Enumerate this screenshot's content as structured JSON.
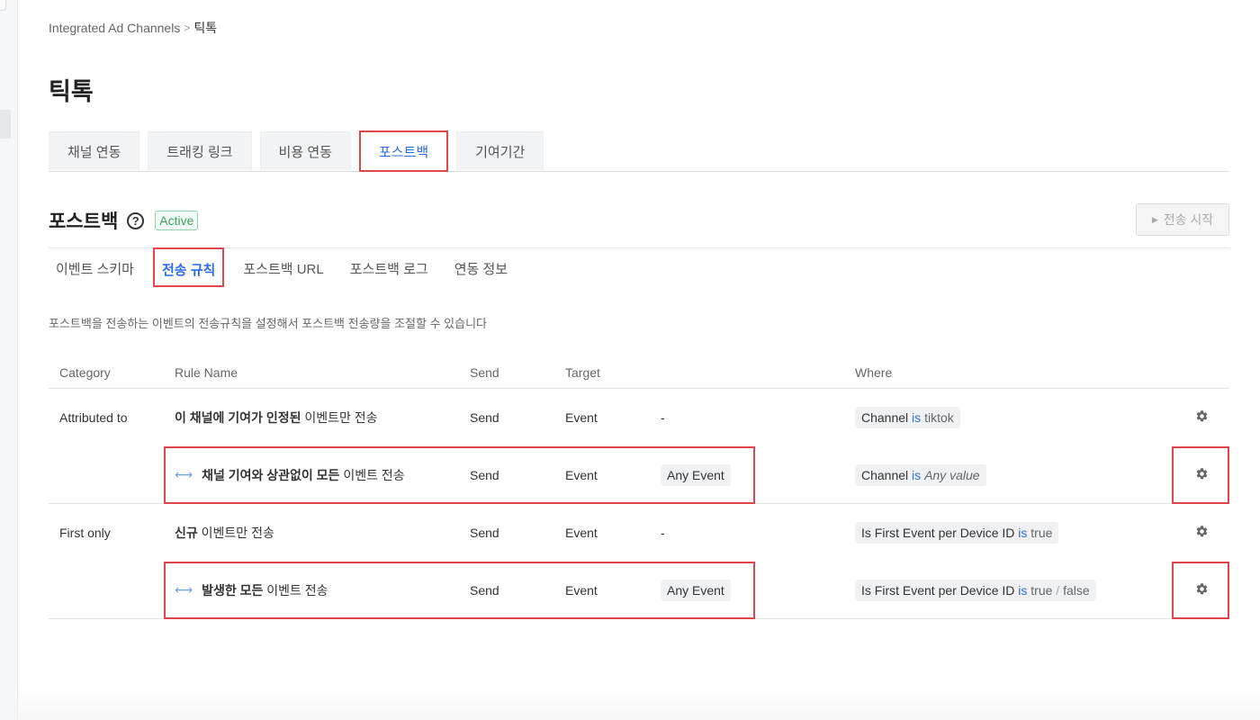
{
  "breadcrumb": {
    "parent": "Integrated Ad Channels",
    "separator": ">",
    "current": "틱톡"
  },
  "page_title": "틱톡",
  "tabs": [
    {
      "label": "채널 연동",
      "active": false
    },
    {
      "label": "트래킹 링크",
      "active": false
    },
    {
      "label": "비용 연동",
      "active": false
    },
    {
      "label": "포스트백",
      "active": true
    },
    {
      "label": "기여기간",
      "active": false
    }
  ],
  "section": {
    "title": "포스트백",
    "help_icon": "question-circle-icon",
    "help_glyph": "?",
    "status": "Active",
    "start_button": {
      "icon": "play-icon",
      "glyph": "▶",
      "label": "전송 시작",
      "disabled": true
    }
  },
  "subtabs": [
    {
      "label": "이벤트 스키마",
      "active": false
    },
    {
      "label": "전송 규칙",
      "active": true
    },
    {
      "label": "포스트백 URL",
      "active": false
    },
    {
      "label": "포스트백 로그",
      "active": false
    },
    {
      "label": "연동 정보",
      "active": false
    }
  ],
  "description": "포스트백을 전송하는 이벤트의 전송규칙을 설정해서 포스트백 전송량을 조절할 수 있습니다",
  "table": {
    "headers": {
      "category": "Category",
      "rule_name": "Rule Name",
      "send": "Send",
      "target": "Target",
      "where": "Where"
    },
    "rows": [
      {
        "category": "Attributed to",
        "name_bold": "이 채널에 기여가 인정된",
        "name_rest": " 이벤트만 전송",
        "linked": false,
        "send": "Send",
        "target": "Event",
        "target_detail": "-",
        "where": {
          "field": "Channel",
          "op": "is",
          "value": "tiktok",
          "value2": "",
          "slash": ""
        }
      },
      {
        "category": "",
        "name_bold": "채널 기여와 상관없이 모든",
        "name_rest": " 이벤트 전송",
        "linked": true,
        "link_glyph": "⟷",
        "send": "Send",
        "target": "Event",
        "target_detail": "Any Event",
        "where": {
          "field": "Channel",
          "op": "is",
          "value": "Any value",
          "value2": "",
          "slash": ""
        }
      },
      {
        "category": "First only",
        "name_bold": "신규",
        "name_rest": " 이벤트만 전송",
        "linked": false,
        "send": "Send",
        "target": "Event",
        "target_detail": "-",
        "where": {
          "field": "Is First Event per Device ID",
          "op": "is",
          "value": "true",
          "value2": "",
          "slash": ""
        }
      },
      {
        "category": "",
        "name_bold": "발생한 모든",
        "name_rest": " 이벤트 전송",
        "linked": true,
        "link_glyph": "⟷",
        "send": "Send",
        "target": "Event",
        "target_detail": "Any Event",
        "where": {
          "field": "Is First Event per Device ID",
          "op": "is",
          "value": "true",
          "value2": "false",
          "slash": " / "
        }
      }
    ],
    "row_icon": "gear-icon"
  },
  "colors": {
    "accent": "#2d6be4",
    "highlight": "#e0464a",
    "active_green": "#3ea364"
  }
}
